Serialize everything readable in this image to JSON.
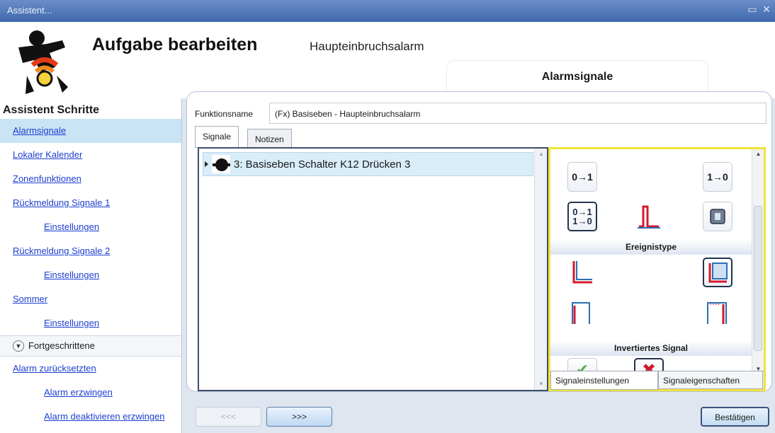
{
  "window": {
    "title": "Assistent..."
  },
  "header": {
    "title": "Aufgabe bearbeiten",
    "subtitle": "Haupteinbruchsalarm",
    "step_tab": "Alarmsignale"
  },
  "sidebar": {
    "heading": "Assistent Schritte",
    "items": [
      {
        "label": "Alarmsignale"
      },
      {
        "label": "Lokaler Kalender"
      },
      {
        "label": "Zonenfunktionen"
      },
      {
        "label": "Rückmeldung Signale 1"
      },
      {
        "label": "Einstellungen"
      },
      {
        "label": "Rückmeldung Signale 2"
      },
      {
        "label": "Einstellungen"
      },
      {
        "label": "Sommer"
      },
      {
        "label": "Einstellungen"
      }
    ],
    "group": "Fortgeschrittene",
    "advanced": [
      {
        "label": "Alarm zurücksetzten"
      },
      {
        "label": "Alarm erzwingen"
      },
      {
        "label": "Alarm deaktivieren erzwingen"
      }
    ]
  },
  "form": {
    "function_name_label": "Funktionsname",
    "function_name_value": "(Fx) Basiseben - Haupteinbruchsalarm"
  },
  "tabs": {
    "signals": "Signale",
    "notes": "Notizen"
  },
  "signals": [
    {
      "label": "3: Basiseben Schalter K12 Drücken 3"
    }
  ],
  "props": {
    "event_type_label": "Ereignistype",
    "inverted_label": "Invertiertes Signal",
    "tab_settings": "Signaleinstellungen",
    "tab_properties": "Signaleigenschaften",
    "icon_rise": "0→1",
    "icon_fall": "1→0",
    "icon_both_top": "0→1",
    "icon_both_bottom": "1→0"
  },
  "buttons": {
    "prev": "<<<",
    "next": ">>>",
    "confirm": "Bestätigen"
  },
  "colors": {
    "accent_yellow": "#f1e43a",
    "titlebar": "#4f78b8",
    "selection": "#c9e4f4",
    "link": "#1d3fd0"
  }
}
